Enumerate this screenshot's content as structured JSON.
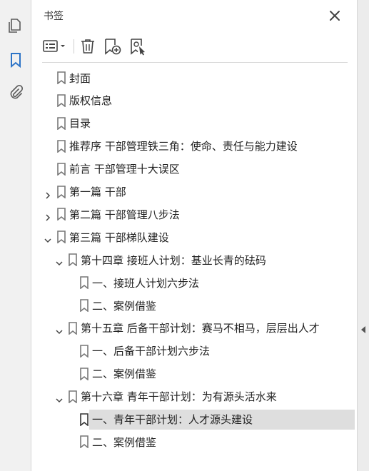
{
  "panel": {
    "title": "书签"
  },
  "icons": {
    "rail": [
      "pages-icon",
      "bookmark-icon",
      "attachment-icon"
    ],
    "toolbar": [
      "options-menu-icon",
      "delete-icon",
      "new-bookmark-icon",
      "bookmark-from-selection-icon"
    ],
    "close": "close-icon"
  },
  "colors": {
    "accent": "#2d74c7",
    "selected_row": "#dedede",
    "icon_gray": "#5a5a5a"
  },
  "bookmarks": [
    {
      "label": "封面",
      "level": 0,
      "twisty": "none",
      "selected": false
    },
    {
      "label": "版权信息",
      "level": 0,
      "twisty": "none",
      "selected": false
    },
    {
      "label": "目录",
      "level": 0,
      "twisty": "none",
      "selected": false
    },
    {
      "label": "推荐序 干部管理铁三角：使命、责任与能力建设",
      "level": 0,
      "twisty": "none",
      "selected": false
    },
    {
      "label": "前言 干部管理十大误区",
      "level": 0,
      "twisty": "none",
      "selected": false
    },
    {
      "label": "第一篇 干部",
      "level": 0,
      "twisty": "collapsed",
      "selected": false
    },
    {
      "label": "第二篇 干部管理八步法",
      "level": 0,
      "twisty": "collapsed",
      "selected": false
    },
    {
      "label": "第三篇 干部梯队建设",
      "level": 0,
      "twisty": "expanded",
      "selected": false
    },
    {
      "label": "第十四章 接班人计划：基业长青的砝码",
      "level": 1,
      "twisty": "expanded",
      "selected": false
    },
    {
      "label": "一、接班人计划六步法",
      "level": 2,
      "twisty": "none",
      "selected": false
    },
    {
      "label": "二、案例借鉴",
      "level": 2,
      "twisty": "none",
      "selected": false
    },
    {
      "label": "第十五章 后备干部计划：赛马不相马，层层出人才",
      "level": 1,
      "twisty": "expanded",
      "selected": false
    },
    {
      "label": "一、后备干部计划六步法",
      "level": 2,
      "twisty": "none",
      "selected": false
    },
    {
      "label": "二、案例借鉴",
      "level": 2,
      "twisty": "none",
      "selected": false
    },
    {
      "label": "第十六章 青年干部计划：为有源头活水来",
      "level": 1,
      "twisty": "expanded",
      "selected": false
    },
    {
      "label": "一、青年干部计划：人才源头建设",
      "level": 2,
      "twisty": "none",
      "selected": true
    },
    {
      "label": "二、案例借鉴",
      "level": 2,
      "twisty": "none",
      "selected": false
    }
  ]
}
